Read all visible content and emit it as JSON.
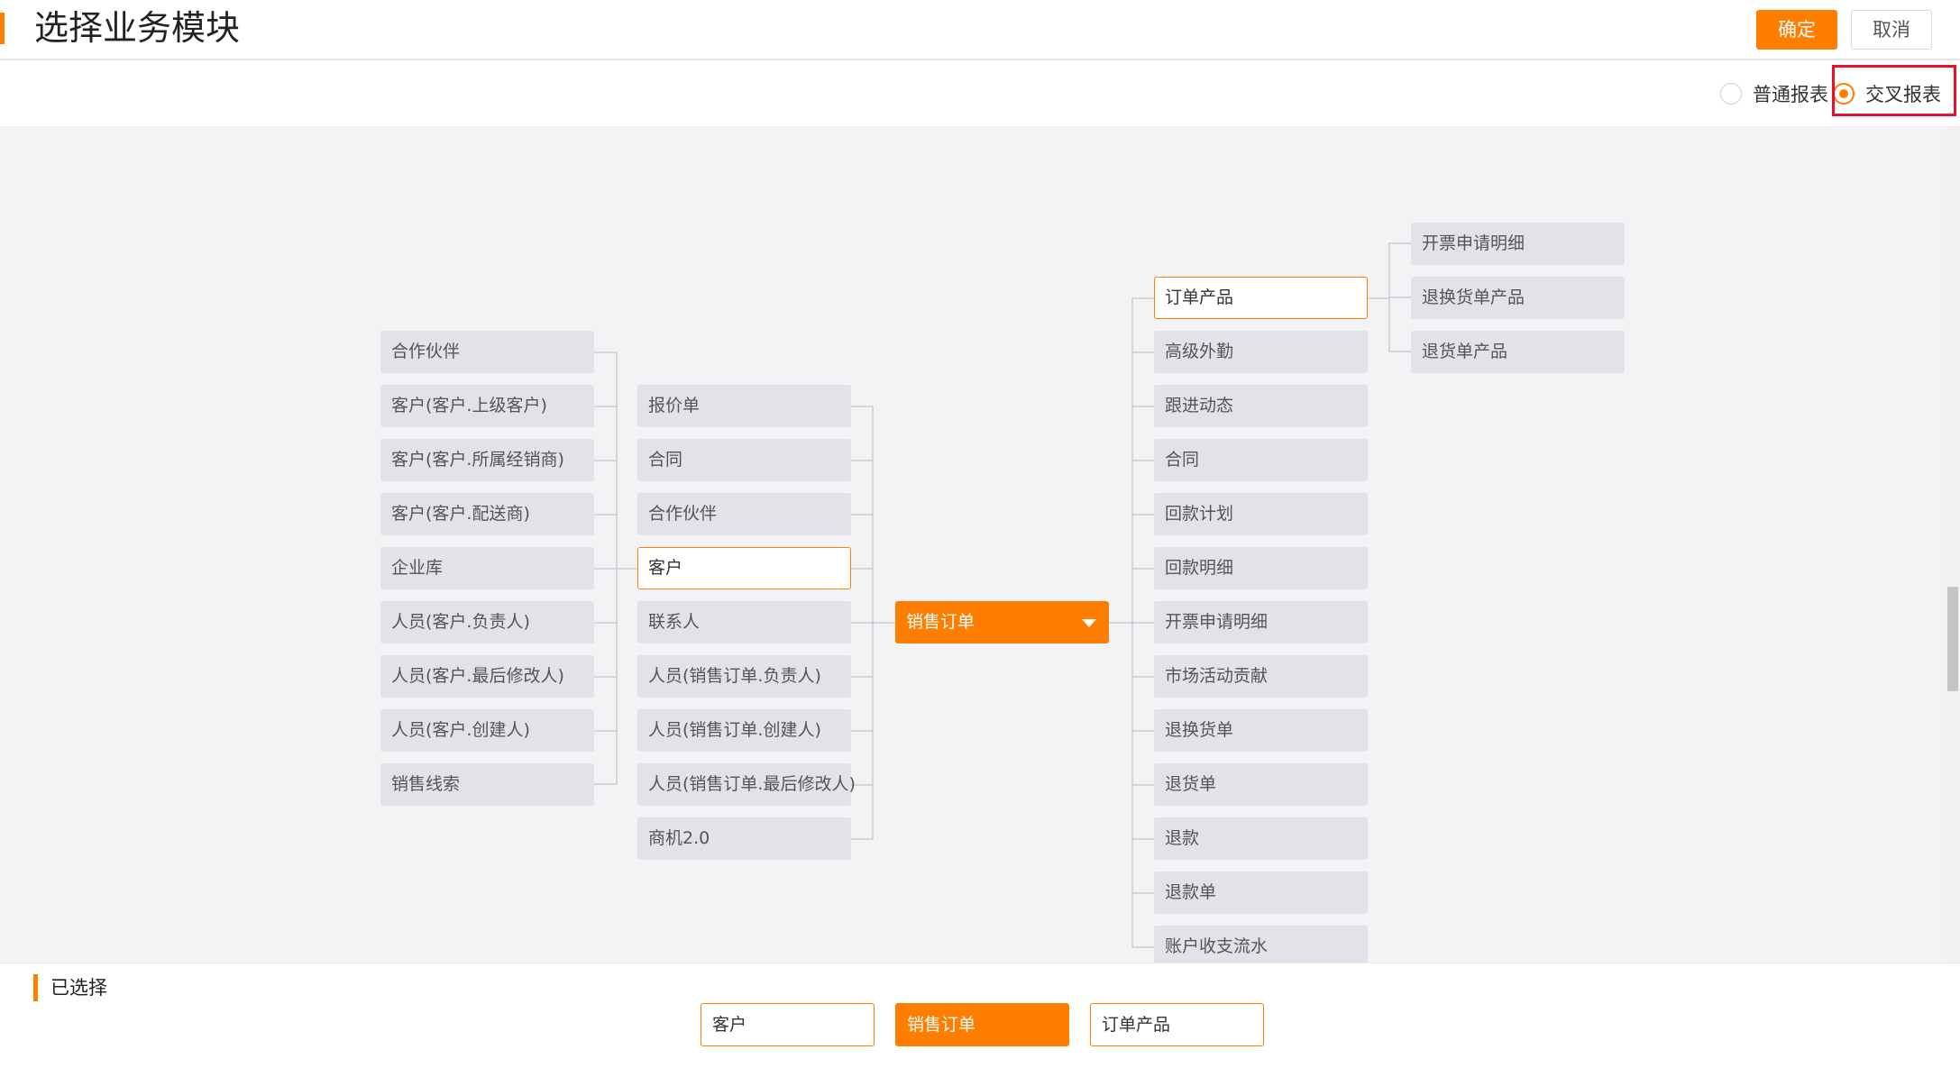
{
  "header": {
    "title": "选择业务模块",
    "confirm_label": "确定",
    "cancel_label": "取消"
  },
  "report_type": {
    "options": [
      {
        "label": "普通报表",
        "checked": false
      },
      {
        "label": "交叉报表",
        "checked": true
      }
    ]
  },
  "tree": {
    "left_column": [
      "合作伙伴",
      "客户(客户.上级客户)",
      "客户(客户.所属经销商)",
      "客户(客户.配送商)",
      "企业库",
      "人员(客户.负责人)",
      "人员(客户.最后修改人)",
      "人员(客户.创建人)",
      "销售线索"
    ],
    "middle_column": [
      "报价单",
      "合同",
      "合作伙伴",
      "客户",
      "联系人",
      "人员(销售订单.负责人)",
      "人员(销售订单.创建人)",
      "人员(销售订单.最后修改人)",
      "商机2.0"
    ],
    "center_node": "销售订单",
    "right_column": [
      "订单产品",
      "高级外勤",
      "跟进动态",
      "合同",
      "回款计划",
      "回款明细",
      "开票申请明细",
      "市场活动贡献",
      "退换货单",
      "退货单",
      "退款",
      "退款单",
      "账户收支流水"
    ],
    "far_right_column": [
      "开票申请明细",
      "退换货单产品",
      "退货单产品"
    ]
  },
  "selected_section": {
    "label": "已选择",
    "chips": [
      "客户",
      "销售订单",
      "订单产品"
    ]
  },
  "colors": {
    "accent": "#ff7e00",
    "node_bg": "#e1e3e8",
    "highlight": "#e8112d"
  }
}
